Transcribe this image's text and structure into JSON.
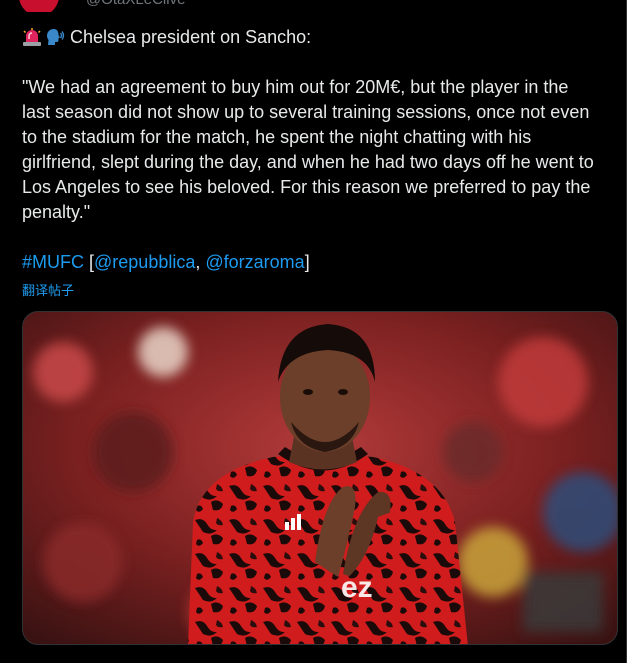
{
  "tweet": {
    "header_handle_partial": "@OtaXLeClive",
    "headline": "Chelsea president on Sancho:",
    "icons": [
      "rotating-light-siren-icon",
      "speaking-head-icon"
    ],
    "body_lines": [
      "\"We had an agreement to buy him out for 20M€, but the player in the",
      "last season did not show up to several training sessions, once not even",
      "to the stadium for the match, he spent the night chatting with his",
      "girlfriend, slept during the day, and when he had two days off he went to",
      "Los Angeles to see his beloved. For this reason we preferred to pay the",
      "penalty.\""
    ],
    "hashtag": "#MUFC",
    "bracket_open": " [",
    "mention_1": "@repubblica",
    "separator": ", ",
    "mention_2": "@forzaroma",
    "bracket_close": "]",
    "translate_label": "翻译帖子"
  },
  "media": {
    "alt": "Player in red patterned training top applauding",
    "colors": {
      "background_red": "#8e1f1f",
      "shirt_red": "#d01c1c",
      "shirt_dark": "#1a0a0a",
      "skin": "#6b3f2a"
    }
  },
  "colors": {
    "background": "#000000",
    "text": "#e7e9ea",
    "link": "#1d9bf0",
    "muted": "#71767b",
    "border": "#2f3336"
  }
}
